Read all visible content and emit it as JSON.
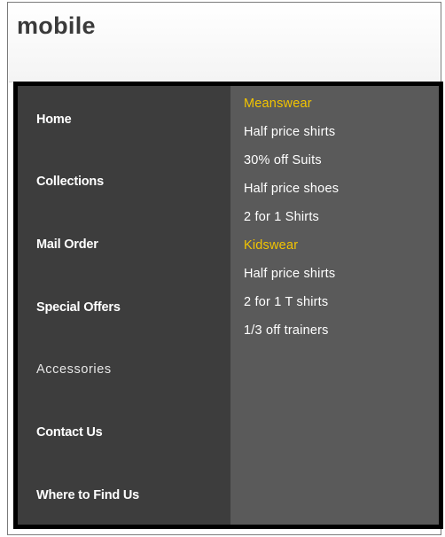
{
  "header": {
    "title": "mobile"
  },
  "nav": {
    "items": [
      {
        "label": "Home"
      },
      {
        "label": "Collections"
      },
      {
        "label": "Mail Order"
      },
      {
        "label": "Special Offers"
      },
      {
        "label": "Accessories"
      },
      {
        "label": "Contact Us"
      },
      {
        "label": "Where to Find Us"
      }
    ]
  },
  "submenu": {
    "groups": [
      {
        "heading": "Meanswear",
        "items": [
          "Half price shirts",
          "30% off Suits",
          "Half price shoes",
          "2 for 1 Shirts"
        ]
      },
      {
        "heading": "Kidswear",
        "items": [
          "Half price shirts",
          "2 for 1 T shirts",
          "1/3 off trainers"
        ]
      }
    ]
  },
  "colors": {
    "accent": "#f2c400",
    "nav_background": "#3d3d3d",
    "submenu_background": "#5a5a5a",
    "frame_border": "#000000"
  }
}
